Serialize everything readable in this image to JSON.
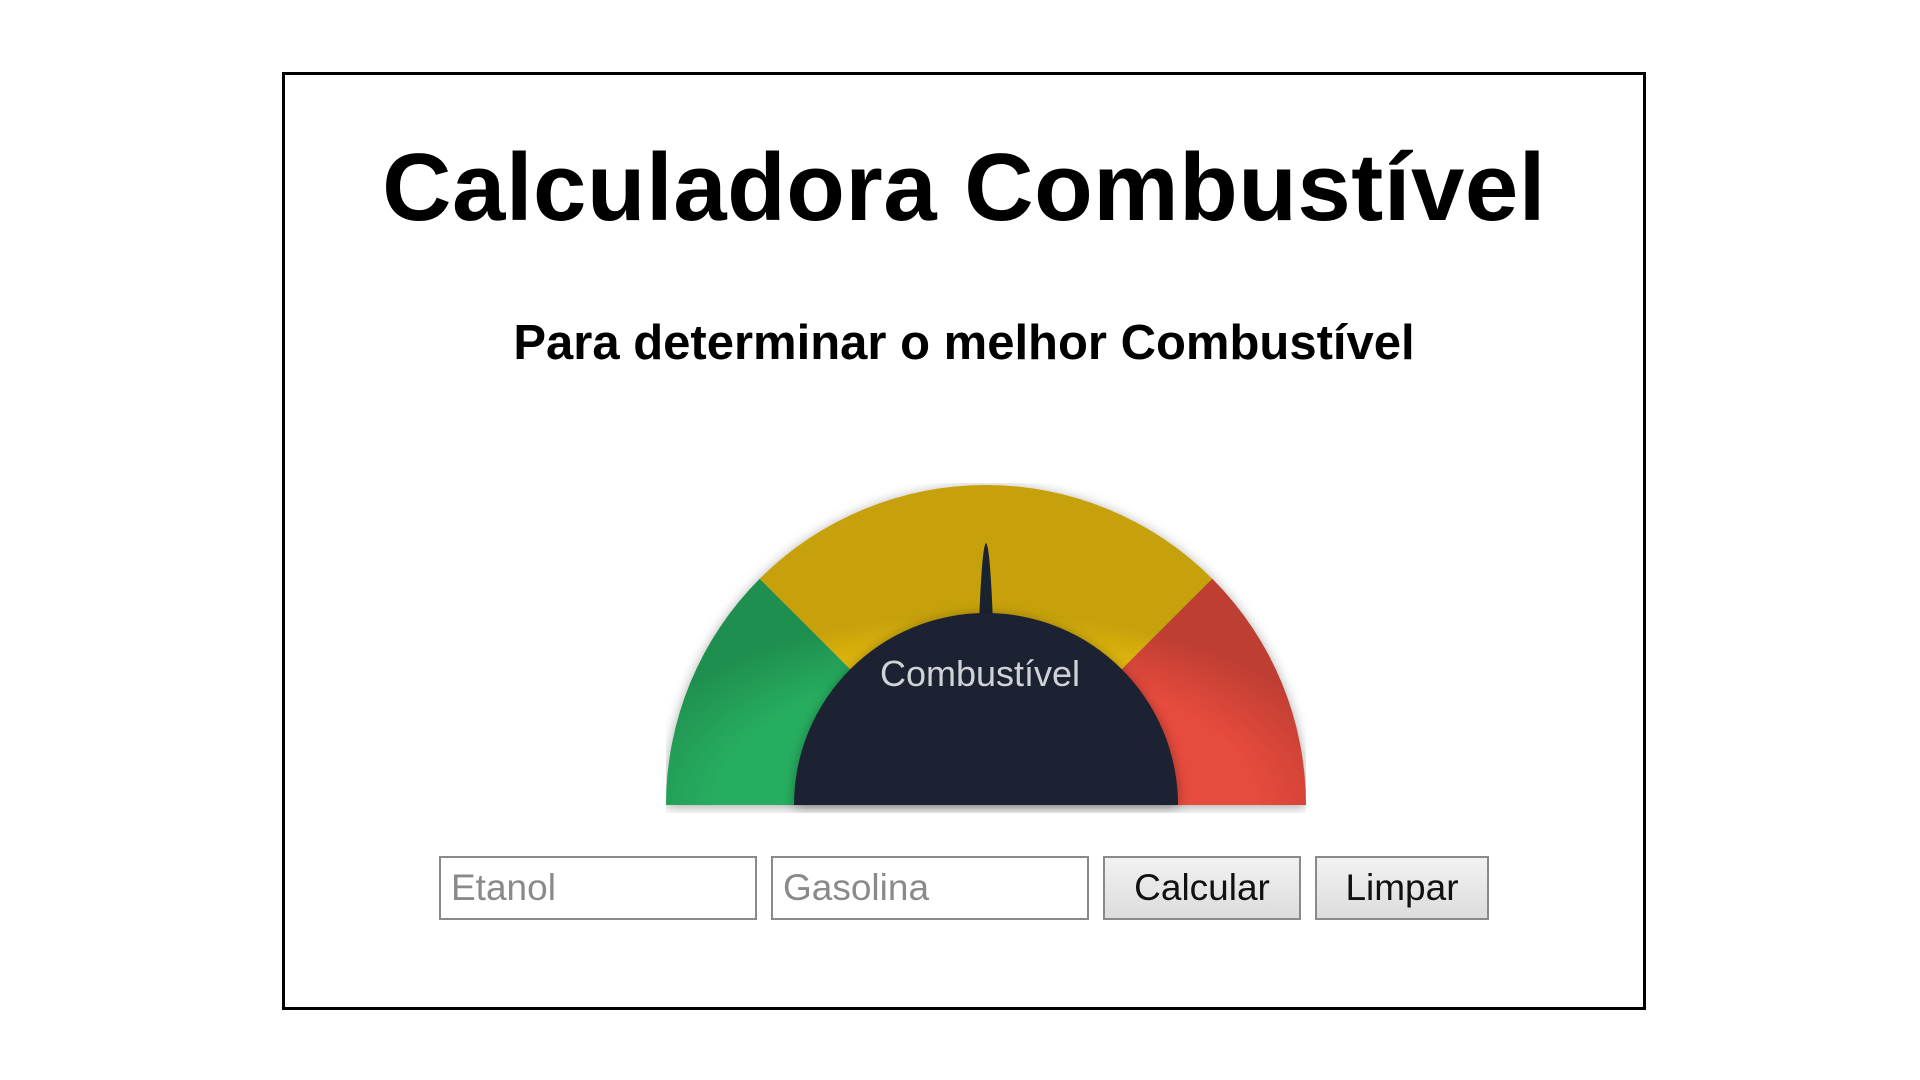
{
  "page": {
    "title": "Calculadora Combustível",
    "subtitle": "Para determinar o melhor Combustível"
  },
  "gauge": {
    "label": "Combustível",
    "colors": {
      "green": "#27ae60",
      "yellow": "#f1c40f",
      "red": "#e74c3c",
      "center": "#1a2330",
      "label": "#cfd3d8"
    },
    "needle_position": 0.5
  },
  "form": {
    "ethanol_placeholder": "Etanol",
    "ethanol_value": "",
    "gasoline_placeholder": "Gasolina",
    "gasoline_value": "",
    "calculate_label": "Calcular",
    "clear_label": "Limpar"
  }
}
